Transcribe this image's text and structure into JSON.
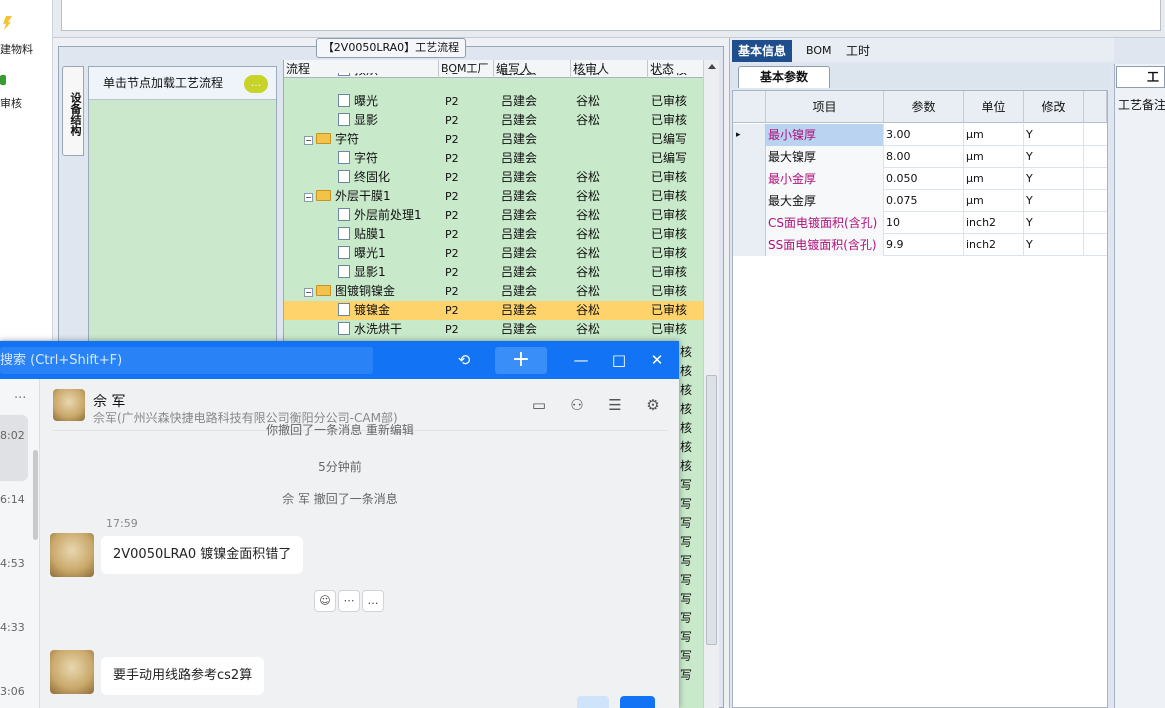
{
  "left_strip": {
    "items": [
      "建物料",
      "审核"
    ]
  },
  "process_panel": {
    "title": "【2V0050LRA0】工艺流程",
    "side_tab": "设备结构",
    "node_hint": "单击节点加载工艺流程",
    "columns": [
      "流程",
      "BOM工厂",
      "编写人",
      "核审人",
      "状态"
    ],
    "rows": [
      {
        "name": "预烘",
        "level": 2,
        "kind": "doc",
        "bom": "P2",
        "writer": "吕建会",
        "reviewer": "谷松",
        "status": "已审核",
        "selected": false,
        "clip": true
      },
      {
        "name": "曝光",
        "level": 2,
        "kind": "doc",
        "bom": "P2",
        "writer": "吕建会",
        "reviewer": "谷松",
        "status": "已审核",
        "selected": false
      },
      {
        "name": "显影",
        "level": 2,
        "kind": "doc",
        "bom": "P2",
        "writer": "吕建会",
        "reviewer": "谷松",
        "status": "已审核",
        "selected": false
      },
      {
        "name": "字符",
        "level": 1,
        "kind": "folder",
        "bom": "P2",
        "writer": "吕建会",
        "reviewer": "",
        "status": "已编写",
        "selected": false
      },
      {
        "name": "字符",
        "level": 2,
        "kind": "doc",
        "bom": "P2",
        "writer": "吕建会",
        "reviewer": "",
        "status": "已编写",
        "selected": false
      },
      {
        "name": "终固化",
        "level": 2,
        "kind": "doc",
        "bom": "P2",
        "writer": "吕建会",
        "reviewer": "谷松",
        "status": "已审核",
        "selected": false
      },
      {
        "name": "外层干膜1",
        "level": 1,
        "kind": "folder",
        "bom": "P2",
        "writer": "吕建会",
        "reviewer": "谷松",
        "status": "已审核",
        "selected": false
      },
      {
        "name": "外层前处理1",
        "level": 2,
        "kind": "doc",
        "bom": "P2",
        "writer": "吕建会",
        "reviewer": "谷松",
        "status": "已审核",
        "selected": false
      },
      {
        "name": "贴膜1",
        "level": 2,
        "kind": "doc",
        "bom": "P2",
        "writer": "吕建会",
        "reviewer": "谷松",
        "status": "已审核",
        "selected": false
      },
      {
        "name": "曝光1",
        "level": 2,
        "kind": "doc",
        "bom": "P2",
        "writer": "吕建会",
        "reviewer": "谷松",
        "status": "已审核",
        "selected": false
      },
      {
        "name": "显影1",
        "level": 2,
        "kind": "doc",
        "bom": "P2",
        "writer": "吕建会",
        "reviewer": "谷松",
        "status": "已审核",
        "selected": false
      },
      {
        "name": "图镀铜镍金",
        "level": 1,
        "kind": "folder",
        "bom": "P2",
        "writer": "吕建会",
        "reviewer": "谷松",
        "status": "已审核",
        "selected": false
      },
      {
        "name": "镀镍金",
        "level": 2,
        "kind": "doc",
        "bom": "P2",
        "writer": "吕建会",
        "reviewer": "谷松",
        "status": "已审核",
        "selected": true
      },
      {
        "name": "水洗烘干",
        "level": 2,
        "kind": "doc",
        "bom": "P2",
        "writer": "吕建会",
        "reviewer": "谷松",
        "status": "已审核",
        "selected": false
      }
    ],
    "status_column_tail": [
      "核",
      "核",
      "核",
      "核",
      "核",
      "核",
      "核",
      "写",
      "写",
      "写",
      "写",
      "写",
      "写",
      "写",
      "写",
      "写",
      "写",
      "写"
    ]
  },
  "right_panel": {
    "tabs": [
      "基本信息",
      "BOM",
      "工时"
    ],
    "active_tab": "基本信息",
    "sub_tab": "基本参数",
    "columns": [
      "项目",
      "参数",
      "单位",
      "修改"
    ],
    "rows": [
      {
        "item": "最小镍厚",
        "value": "3.00",
        "unit": "μm",
        "edit": "Y",
        "highlight": true,
        "current": true
      },
      {
        "item": "最大镍厚",
        "value": "8.00",
        "unit": "μm",
        "edit": "Y",
        "highlight": false,
        "current": false
      },
      {
        "item": "最小金厚",
        "value": "0.050",
        "unit": "μm",
        "edit": "Y",
        "highlight": true,
        "current": false
      },
      {
        "item": "最大金厚",
        "value": "0.075",
        "unit": "μm",
        "edit": "Y",
        "highlight": false,
        "current": false
      },
      {
        "item": "CS面电镀面积(含孔)",
        "value": "10",
        "unit": "inch2",
        "edit": "Y",
        "highlight": true,
        "current": false
      },
      {
        "item": "SS面电镀面积(含孔)",
        "value": "9.9",
        "unit": "inch2",
        "edit": "Y",
        "highlight": true,
        "current": false
      }
    ],
    "far_tab": "工",
    "far_label": "工艺备注"
  },
  "chat": {
    "search_placeholder": "搜索 (Ctrl+Shift+F)",
    "contact_name": "佘 军",
    "contact_org": "佘军(广州兴森快捷电路科技有限公司衡阳分公司-CAM部)",
    "recall_partial": "你撤回了一条消息  重新编辑",
    "ago": "5分钟前",
    "recall_notice": "佘 军 撤回了一条消息",
    "msg_time": "17:59",
    "messages": [
      "2V0050LRA0 镀镍金面积错了",
      "要手动用线路参考cs2算"
    ],
    "list_times": [
      "8:02",
      "6:14",
      "4:53",
      "4:33",
      "3:06"
    ],
    "list_dots": "···"
  },
  "colors": {
    "accent": "#1273f4",
    "magenta": "#b0117c",
    "tree_bg": "#c9e9cb",
    "select": "#ffd36b"
  }
}
